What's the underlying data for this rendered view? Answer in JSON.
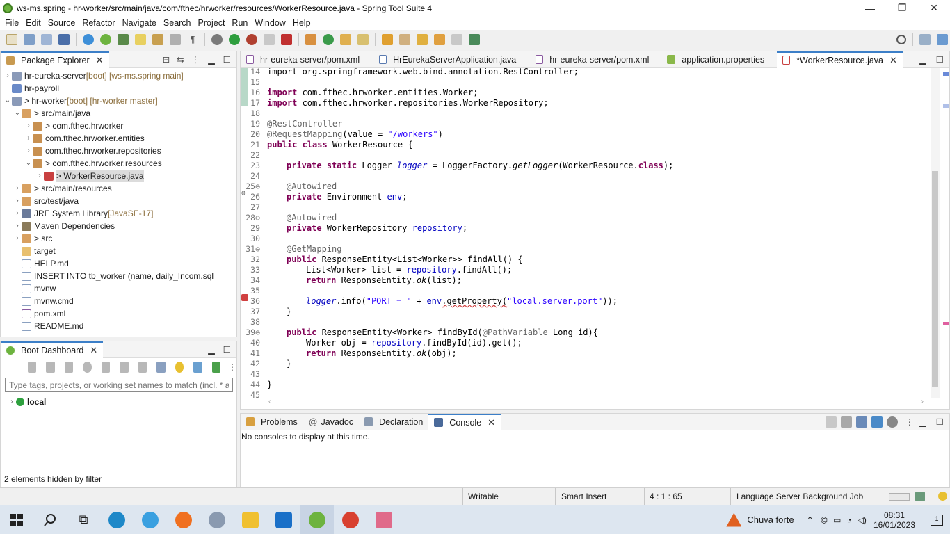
{
  "window": {
    "title": "ws-ms.spring - hr-worker/src/main/java/com/fthec/hrworker/resources/WorkerResource.java - Spring Tool Suite 4",
    "minimize": "—",
    "restore": "❐",
    "close": "✕"
  },
  "menu": [
    "File",
    "Edit",
    "Source",
    "Refactor",
    "Navigate",
    "Search",
    "Project",
    "Run",
    "Window",
    "Help"
  ],
  "package_explorer": {
    "title": "Package Explorer",
    "items": [
      {
        "label": "hr-eureka-server",
        "deco": " [boot] [ws-ms.spring main]"
      },
      {
        "label": "hr-payroll",
        "deco": ""
      },
      {
        "label": "> hr-worker",
        "deco": " [boot] [hr-worker master]"
      },
      {
        "label": "> src/main/java",
        "deco": ""
      },
      {
        "label": "> com.fthec.hrworker",
        "deco": ""
      },
      {
        "label": "com.fthec.hrworker.entities",
        "deco": ""
      },
      {
        "label": "com.fthec.hrworker.repositories",
        "deco": ""
      },
      {
        "label": "> com.fthec.hrworker.resources",
        "deco": ""
      },
      {
        "label": "> WorkerResource.java",
        "deco": ""
      },
      {
        "label": "> src/main/resources",
        "deco": ""
      },
      {
        "label": "src/test/java",
        "deco": ""
      },
      {
        "label": "JRE System Library",
        "deco": " [JavaSE-17]"
      },
      {
        "label": "Maven Dependencies",
        "deco": ""
      },
      {
        "label": "> src",
        "deco": ""
      },
      {
        "label": "target",
        "deco": ""
      },
      {
        "label": "HELP.md",
        "deco": ""
      },
      {
        "label": "INSERT INTO tb_worker (name, daily_Incom.sql",
        "deco": ""
      },
      {
        "label": "mvnw",
        "deco": ""
      },
      {
        "label": "mvnw.cmd",
        "deco": ""
      },
      {
        "label": "pom.xml",
        "deco": ""
      },
      {
        "label": "README.md",
        "deco": ""
      }
    ]
  },
  "boot_dashboard": {
    "title": "Boot Dashboard",
    "filter_placeholder": "Type tags, projects, or working set names to match (incl. * an",
    "local": "local",
    "hidden": "2 elements hidden by filter"
  },
  "editor_tabs": [
    "hr-eureka-server/pom.xml",
    "HrEurekaServerApplication.java",
    "hr-eureka-server/pom.xml",
    "application.properties",
    "*WorkerResource.java"
  ],
  "code": {
    "l14": "import org.springframework.web.bind.annotation.RestController;",
    "imp16a": "import",
    "imp16b": " com.fthec.hrworker.entities.Worker;",
    "imp17a": "import",
    "imp17b": " com.fthec.hrworker.repositories.WorkerRepository;",
    "rc": "@RestController",
    "rm1": "@RequestMapping",
    "rm2": "(value = ",
    "rm3": "\"/workers\"",
    "rm4": ")",
    "pub": "public",
    "cls": "class",
    "clsname": " WorkerResource {",
    "priv": "private",
    "stat": "static",
    "lg1": " Logger ",
    "lg2": "logger",
    "lg3": " = LoggerFactory.",
    "lg4": "getLogger",
    "lg5": "(WorkerResource.",
    "lg6": "class",
    "lg7": ");",
    "aw": "@Autowired",
    "env1": " Environment ",
    "env2": "env",
    "semi": ";",
    "rep1": " WorkerRepository ",
    "rep2": "repository",
    "gm": "@GetMapping",
    "fa": " ResponseEntity<List<Worker>> findAll() {",
    "l33a": "List<Worker> list = ",
    "l33b": "repository",
    "l33c": ".findAll();",
    "ret": "return",
    "l34a": " ResponseEntity.",
    "l34b": "ok",
    "l34c": "(list);",
    "l36a": "logger",
    "l36b": ".info(",
    "l36c": "\"PORT = \"",
    "l36d": " + ",
    "l36e": "env",
    "l36f": ".getProperty(",
    "l36g": "\"local.server.port\"",
    "l36h": "));",
    "brace": "}",
    "l39a": " ResponseEntity<Worker> findById(",
    "l39b": "@PathVariable",
    "l39c": " Long id){",
    "l40a": "Worker obj = ",
    "l40b": "repository",
    "l40c": ".findById(id).get();",
    "l41c": "(obj);"
  },
  "line_numbers": [
    "14",
    "15",
    "16",
    "17",
    "18",
    "19",
    "20",
    "21",
    "22",
    "23",
    "24",
    "25⊖",
    "26",
    "27",
    "28⊖",
    "29",
    "30",
    "31⊖",
    "32",
    "33",
    "34",
    "35",
    "36",
    "37",
    "38",
    "39⊖",
    "40",
    "41",
    "42",
    "43",
    "44",
    "45"
  ],
  "bottom_tabs": [
    "Problems",
    "Javadoc",
    "Declaration",
    "Console"
  ],
  "console_msg": "No consoles to display at this time.",
  "status": {
    "writable": "Writable",
    "insert": "Smart Insert",
    "pos": "4 : 1 : 65",
    "job": "Language Server Background Job"
  },
  "taskbar": {
    "weather": "Chuva forte",
    "time": "08:31",
    "date": "16/01/2023",
    "notif": "1"
  }
}
